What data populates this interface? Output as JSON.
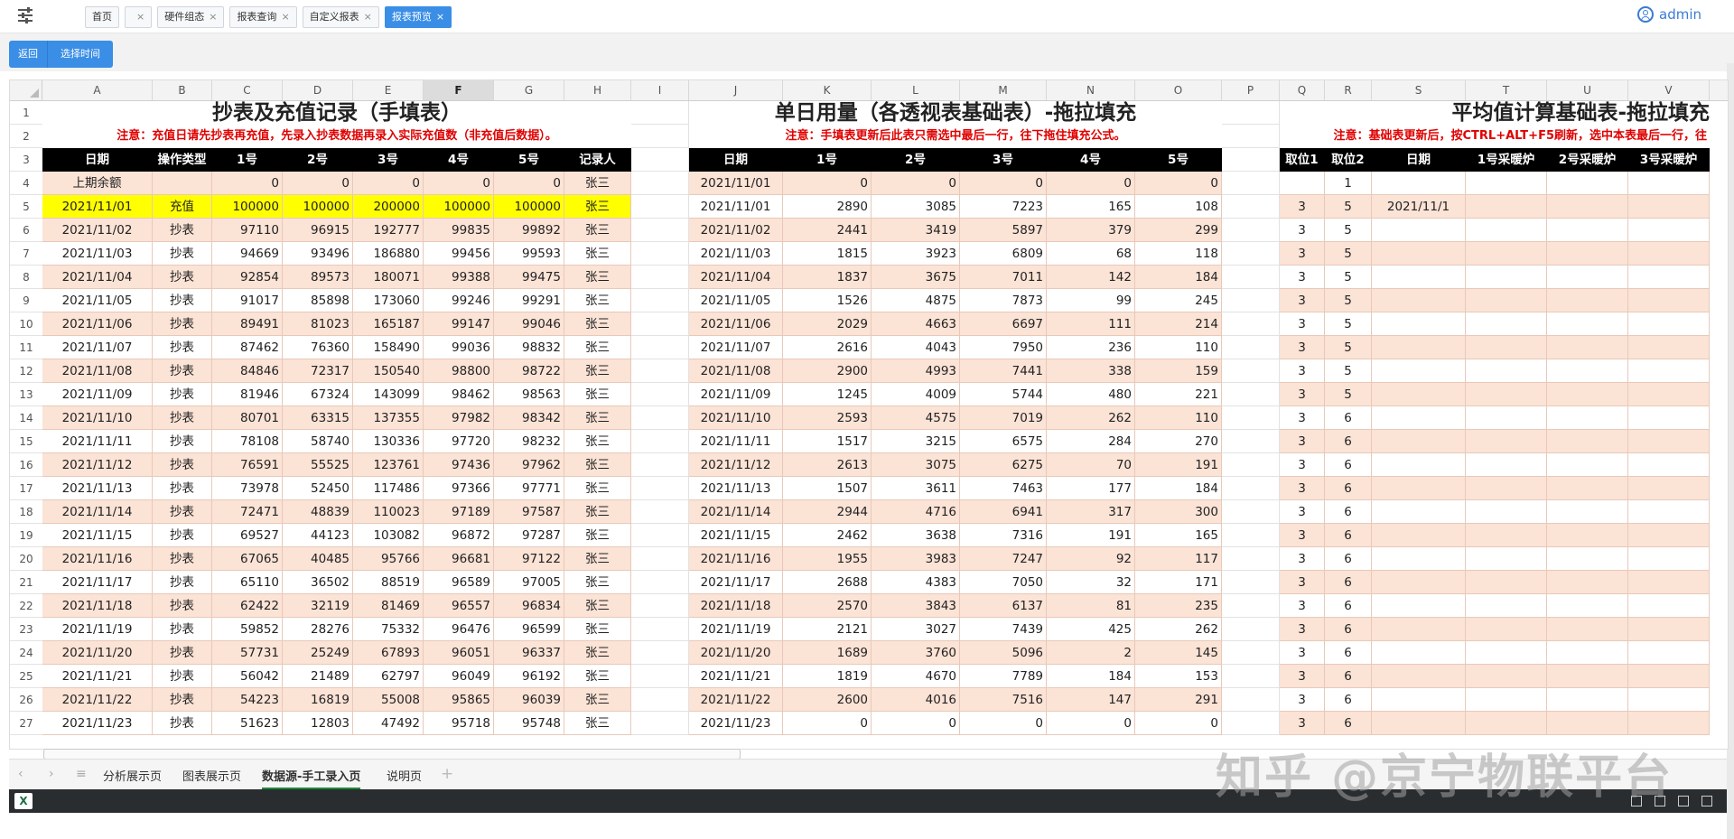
{
  "topbar": {
    "tabs": [
      {
        "label": "首页",
        "closable": false,
        "active": false
      },
      {
        "label": "",
        "closable": true,
        "active": false
      },
      {
        "label": "硬件组态",
        "closable": true,
        "active": false
      },
      {
        "label": "报表查询",
        "closable": true,
        "active": false
      },
      {
        "label": "自定义报表",
        "closable": true,
        "active": false
      },
      {
        "label": "报表预览",
        "closable": true,
        "active": true
      }
    ],
    "close_glyph": "×",
    "user": "admin"
  },
  "toolbar": {
    "back_label": "返回",
    "time_label": "选择时间"
  },
  "sheet": {
    "columns": [
      "A",
      "B",
      "C",
      "D",
      "E",
      "F",
      "G",
      "H",
      "I",
      "J",
      "K",
      "L",
      "M",
      "N",
      "O",
      "P",
      "Q",
      "R",
      "S",
      "T",
      "U",
      "V"
    ],
    "selected_column": "F",
    "row_numbers": [
      "1",
      "2",
      "3",
      "4",
      "5",
      "6",
      "7",
      "8",
      "9",
      "10",
      "11",
      "12",
      "13",
      "14",
      "15",
      "16",
      "17",
      "18",
      "19",
      "20",
      "21",
      "22",
      "23",
      "24",
      "25",
      "26",
      "27"
    ],
    "section1": {
      "title": "抄表及充值记录（手填表）",
      "note": "注意：充值日请先抄表再充值，先录入抄表数据再录入实际充值数（非充值后数据）。",
      "headers": [
        "日期",
        "操作类型",
        "1号",
        "2号",
        "3号",
        "4号",
        "5号",
        "记录人"
      ],
      "rows": [
        [
          "上期余额",
          "",
          "0",
          "0",
          "0",
          "0",
          "0",
          "张三"
        ],
        [
          "2021/11/01",
          "充值",
          "100000",
          "100000",
          "200000",
          "100000",
          "100000",
          "张三"
        ],
        [
          "2021/11/02",
          "抄表",
          "97110",
          "96915",
          "192777",
          "99835",
          "99892",
          "张三"
        ],
        [
          "2021/11/03",
          "抄表",
          "94669",
          "93496",
          "186880",
          "99456",
          "99593",
          "张三"
        ],
        [
          "2021/11/04",
          "抄表",
          "92854",
          "89573",
          "180071",
          "99388",
          "99475",
          "张三"
        ],
        [
          "2021/11/05",
          "抄表",
          "91017",
          "85898",
          "173060",
          "99246",
          "99291",
          "张三"
        ],
        [
          "2021/11/06",
          "抄表",
          "89491",
          "81023",
          "165187",
          "99147",
          "99046",
          "张三"
        ],
        [
          "2021/11/07",
          "抄表",
          "87462",
          "76360",
          "158490",
          "99036",
          "98832",
          "张三"
        ],
        [
          "2021/11/08",
          "抄表",
          "84846",
          "72317",
          "150540",
          "98800",
          "98722",
          "张三"
        ],
        [
          "2021/11/09",
          "抄表",
          "81946",
          "67324",
          "143099",
          "98462",
          "98563",
          "张三"
        ],
        [
          "2021/11/10",
          "抄表",
          "80701",
          "63315",
          "137355",
          "97982",
          "98342",
          "张三"
        ],
        [
          "2021/11/11",
          "抄表",
          "78108",
          "58740",
          "130336",
          "97720",
          "98232",
          "张三"
        ],
        [
          "2021/11/12",
          "抄表",
          "76591",
          "55525",
          "123761",
          "97436",
          "97962",
          "张三"
        ],
        [
          "2021/11/13",
          "抄表",
          "73978",
          "52450",
          "117486",
          "97366",
          "97771",
          "张三"
        ],
        [
          "2021/11/14",
          "抄表",
          "72471",
          "48839",
          "110023",
          "97189",
          "97587",
          "张三"
        ],
        [
          "2021/11/15",
          "抄表",
          "69527",
          "44123",
          "103082",
          "96872",
          "97287",
          "张三"
        ],
        [
          "2021/11/16",
          "抄表",
          "67065",
          "40485",
          "95766",
          "96681",
          "97122",
          "张三"
        ],
        [
          "2021/11/17",
          "抄表",
          "65110",
          "36502",
          "88519",
          "96589",
          "97005",
          "张三"
        ],
        [
          "2021/11/18",
          "抄表",
          "62422",
          "32119",
          "81469",
          "96557",
          "96834",
          "张三"
        ],
        [
          "2021/11/19",
          "抄表",
          "59852",
          "28276",
          "75332",
          "96476",
          "96599",
          "张三"
        ],
        [
          "2021/11/20",
          "抄表",
          "57731",
          "25249",
          "67893",
          "96051",
          "96337",
          "张三"
        ],
        [
          "2021/11/21",
          "抄表",
          "56042",
          "21489",
          "62797",
          "96049",
          "96192",
          "张三"
        ],
        [
          "2021/11/22",
          "抄表",
          "54223",
          "16819",
          "55008",
          "95865",
          "96039",
          "张三"
        ],
        [
          "2021/11/23",
          "抄表",
          "51623",
          "12803",
          "47492",
          "95718",
          "95748",
          "张三"
        ]
      ],
      "highlight_color": "#ffff00",
      "stripe_color": "#fbe3d6"
    },
    "section2": {
      "title": "单日用量（各透视表基础表）-拖拉填充",
      "note": "注意：手填表更新后此表只需选中最后一行，往下拖住填充公式。",
      "headers": [
        "日期",
        "1号",
        "2号",
        "3号",
        "4号",
        "5号"
      ],
      "rows": [
        [
          "2021/11/01",
          "0",
          "0",
          "0",
          "0",
          "0"
        ],
        [
          "2021/11/01",
          "2890",
          "3085",
          "7223",
          "165",
          "108"
        ],
        [
          "2021/11/02",
          "2441",
          "3419",
          "5897",
          "379",
          "299"
        ],
        [
          "2021/11/03",
          "1815",
          "3923",
          "6809",
          "68",
          "118"
        ],
        [
          "2021/11/04",
          "1837",
          "3675",
          "7011",
          "142",
          "184"
        ],
        [
          "2021/11/05",
          "1526",
          "4875",
          "7873",
          "99",
          "245"
        ],
        [
          "2021/11/06",
          "2029",
          "4663",
          "6697",
          "111",
          "214"
        ],
        [
          "2021/11/07",
          "2616",
          "4043",
          "7950",
          "236",
          "110"
        ],
        [
          "2021/11/08",
          "2900",
          "4993",
          "7441",
          "338",
          "159"
        ],
        [
          "2021/11/09",
          "1245",
          "4009",
          "5744",
          "480",
          "221"
        ],
        [
          "2021/11/10",
          "2593",
          "4575",
          "7019",
          "262",
          "110"
        ],
        [
          "2021/11/11",
          "1517",
          "3215",
          "6575",
          "284",
          "270"
        ],
        [
          "2021/11/12",
          "2613",
          "3075",
          "6275",
          "70",
          "191"
        ],
        [
          "2021/11/13",
          "1507",
          "3611",
          "7463",
          "177",
          "184"
        ],
        [
          "2021/11/14",
          "2944",
          "4716",
          "6941",
          "317",
          "300"
        ],
        [
          "2021/11/15",
          "2462",
          "3638",
          "7316",
          "191",
          "165"
        ],
        [
          "2021/11/16",
          "1955",
          "3983",
          "7247",
          "92",
          "117"
        ],
        [
          "2021/11/17",
          "2688",
          "4383",
          "7050",
          "32",
          "171"
        ],
        [
          "2021/11/18",
          "2570",
          "3843",
          "6137",
          "81",
          "235"
        ],
        [
          "2021/11/19",
          "2121",
          "3027",
          "7439",
          "425",
          "262"
        ],
        [
          "2021/11/20",
          "1689",
          "3760",
          "5096",
          "2",
          "145"
        ],
        [
          "2021/11/21",
          "1819",
          "4670",
          "7789",
          "184",
          "153"
        ],
        [
          "2021/11/22",
          "2600",
          "4016",
          "7516",
          "147",
          "291"
        ],
        [
          "2021/11/23",
          "0",
          "0",
          "0",
          "0",
          "0"
        ]
      ]
    },
    "section3": {
      "title": "平均值计算基础表-拖拉填充",
      "note": "注意：基础表更新后，按CTRL+ALT+F5刷新，选中本表最后一行，往",
      "headers": [
        "取位1",
        "取位2",
        "日期",
        "1号采暖炉",
        "2号采暖炉",
        "3号采暖炉"
      ],
      "rows": [
        [
          "",
          "1",
          "",
          "",
          "",
          ""
        ],
        [
          "3",
          "5",
          "2021/11/1",
          "",
          "",
          ""
        ],
        [
          "3",
          "5",
          "",
          "",
          "",
          ""
        ],
        [
          "3",
          "5",
          "",
          "",
          "",
          ""
        ],
        [
          "3",
          "5",
          "",
          "",
          "",
          ""
        ],
        [
          "3",
          "5",
          "",
          "",
          "",
          ""
        ],
        [
          "3",
          "5",
          "",
          "",
          "",
          ""
        ],
        [
          "3",
          "5",
          "",
          "",
          "",
          ""
        ],
        [
          "3",
          "5",
          "",
          "",
          "",
          ""
        ],
        [
          "3",
          "5",
          "",
          "",
          "",
          ""
        ],
        [
          "3",
          "6",
          "",
          "",
          "",
          ""
        ],
        [
          "3",
          "6",
          "",
          "",
          "",
          ""
        ],
        [
          "3",
          "6",
          "",
          "",
          "",
          ""
        ],
        [
          "3",
          "6",
          "",
          "",
          "",
          ""
        ],
        [
          "3",
          "6",
          "",
          "",
          "",
          ""
        ],
        [
          "3",
          "6",
          "",
          "",
          "",
          ""
        ],
        [
          "3",
          "6",
          "",
          "",
          "",
          ""
        ],
        [
          "3",
          "6",
          "",
          "",
          "",
          ""
        ],
        [
          "3",
          "6",
          "",
          "",
          "",
          ""
        ],
        [
          "3",
          "6",
          "",
          "",
          "",
          ""
        ],
        [
          "3",
          "6",
          "",
          "",
          "",
          ""
        ],
        [
          "3",
          "6",
          "",
          "",
          "",
          ""
        ],
        [
          "3",
          "6",
          "",
          "",
          "",
          ""
        ],
        [
          "3",
          "6",
          "",
          "",
          "",
          ""
        ]
      ]
    }
  },
  "sheet_tabs": {
    "items": [
      "分析展示页",
      "图表展示页",
      "数据源-手工录入页",
      "说明页"
    ],
    "active_index": 2,
    "add_glyph": "+"
  },
  "watermark": "知乎 @京宁物联平台"
}
